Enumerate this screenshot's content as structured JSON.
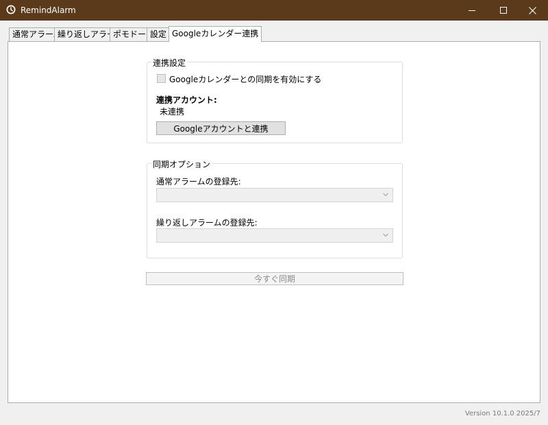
{
  "window": {
    "title": "RemindAlarm",
    "app_icon": "clock-icon",
    "controls": [
      "minimize-icon",
      "maximize-icon",
      "close-icon"
    ]
  },
  "tabs": [
    {
      "label": "通常アラーム",
      "active": false
    },
    {
      "label": "繰り返しアラーム",
      "active": false
    },
    {
      "label": "ポモドーロ",
      "active": false
    },
    {
      "label": "設定",
      "active": false
    },
    {
      "label": "Googleカレンダー連携",
      "active": true
    }
  ],
  "link_settings": {
    "legend": "連携設定",
    "sync_checkbox_label": "Googleカレンダーとの同期を有効にする",
    "sync_checked": false,
    "account_label": "連携アカウント:",
    "account_value": "未連携",
    "link_button_label": "Googleアカウントと連携"
  },
  "sync_options": {
    "legend": "同期オプション",
    "normal_label": "通常アラームの登録先:",
    "normal_value": "",
    "repeat_label": "繰り返しアラームの登録先:",
    "repeat_value": ""
  },
  "sync_now_button_label": "今すぐ同期",
  "version_text": "Version 10.1.0 2025/7"
}
